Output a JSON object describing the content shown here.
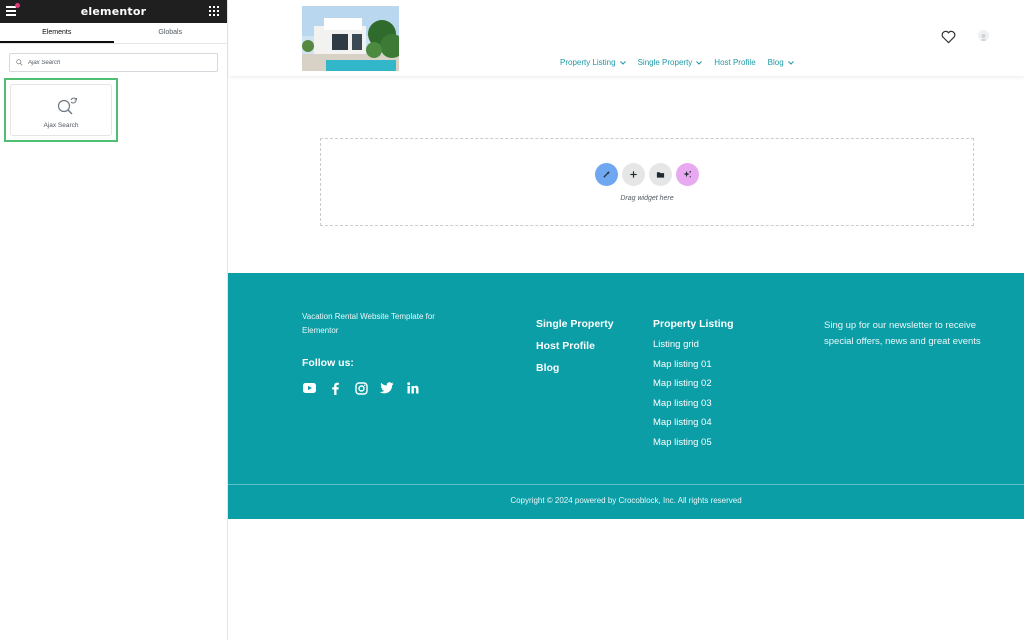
{
  "editor": {
    "brand": "elementor",
    "tabs": [
      "Elements",
      "Globals"
    ],
    "search": {
      "value": "Ajax Search"
    },
    "widget": {
      "label": "Ajax Search"
    }
  },
  "header": {
    "nav": [
      {
        "label": "Property Listing",
        "dropdown": true
      },
      {
        "label": "Single Property",
        "dropdown": true
      },
      {
        "label": "Host Profile",
        "dropdown": false
      },
      {
        "label": "Blog",
        "dropdown": true
      }
    ],
    "icons": [
      "heart-icon",
      "user-avatar"
    ]
  },
  "dropzone": {
    "label": "Drag widget here",
    "buttons": [
      {
        "icon": "magic-wand-icon",
        "color": "#6fa8f0"
      },
      {
        "icon": "plus-icon",
        "color": "#e6e6e6"
      },
      {
        "icon": "folder-icon",
        "color": "#e6e6e6"
      },
      {
        "icon": "sparkle-icon",
        "color": "#e9a9f0"
      }
    ]
  },
  "footer": {
    "description": "Vacation Rental Website Template for Elementor",
    "follow_label": "Follow us:",
    "socials": [
      "youtube-icon",
      "facebook-icon",
      "instagram-icon",
      "twitter-icon",
      "linkedin-icon"
    ],
    "col1": [
      "Single Property",
      "Host Profile",
      "Blog"
    ],
    "col2": {
      "heading": "Property Listing",
      "links": [
        "Listing grid",
        "Map listing 01",
        "Map listing 02",
        "Map listing 03",
        "Map listing 04",
        "Map listing 05"
      ]
    },
    "newsletter": "Sing up for our newsletter to receive special offers, news and great events",
    "copyright": "Copyright © 2024 powered by Crocoblock, Inc. All rights reserved"
  },
  "colors": {
    "teal": "#0b9ea6",
    "nav_text": "#1a9aa6",
    "highlight_border": "#4fbf73"
  }
}
